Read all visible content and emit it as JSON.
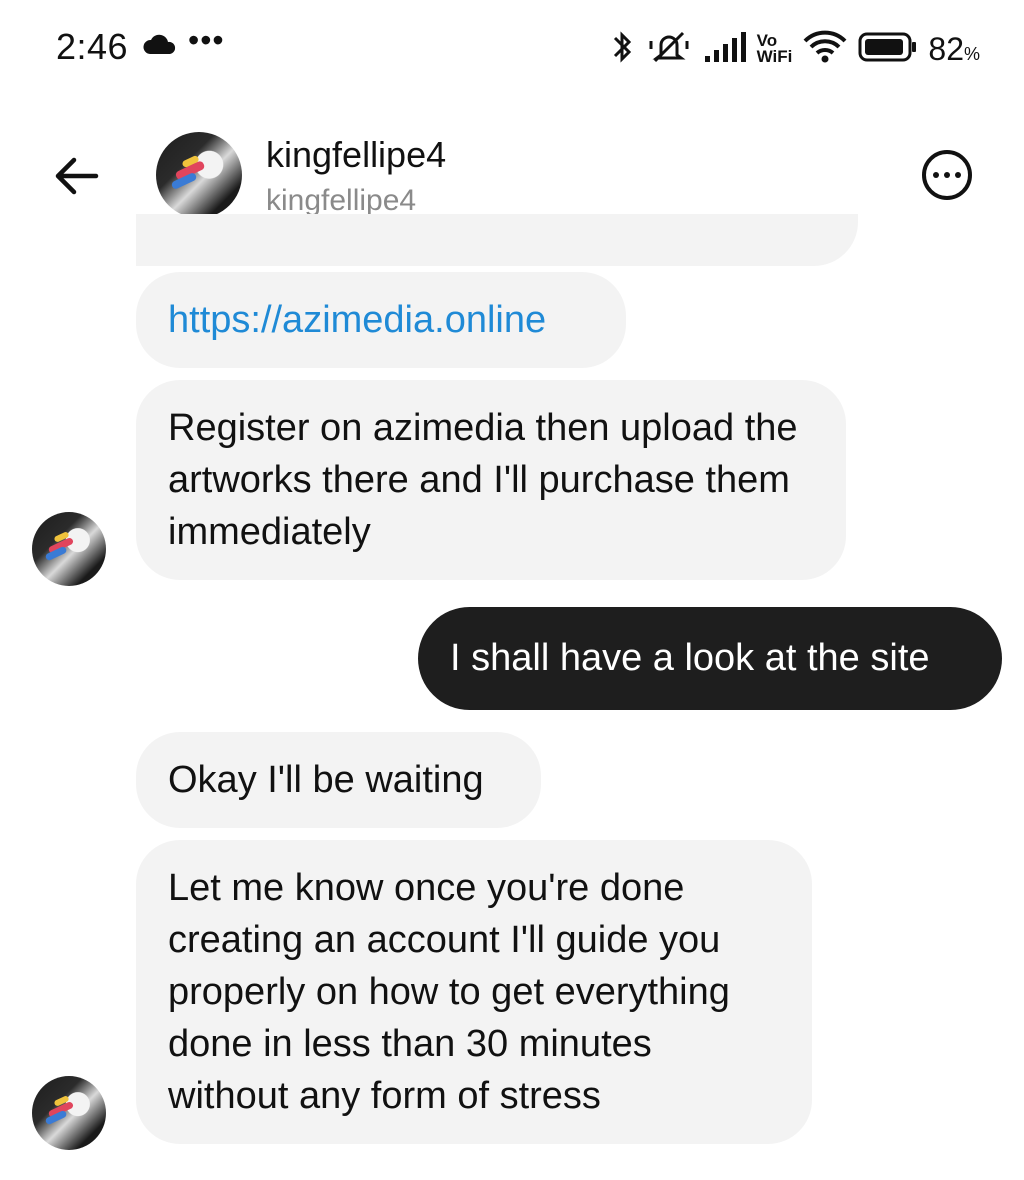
{
  "status_bar": {
    "time": "2:46",
    "overflow_dots": "•••",
    "vo_top": "Vo",
    "vo_bottom": "WiFi",
    "battery_percent": "82",
    "battery_unit": "%"
  },
  "header": {
    "display_name": "kingfellipe4",
    "username": "kingfellipe4"
  },
  "messages": [
    {
      "sender": "them",
      "text": "https://azimedia.online"
    },
    {
      "sender": "them",
      "text": "Register on azimedia then upload the artworks there and I'll purchase them immediately"
    },
    {
      "sender": "me",
      "text": "I shall have a look at the site"
    },
    {
      "sender": "them",
      "text": "Okay I'll be waiting"
    },
    {
      "sender": "them",
      "text": "Let me know once you're done creating an account I'll guide you properly on how to get everything done in less than 30 minutes without any form of stress"
    }
  ],
  "colors": {
    "incoming_bubble": "#f3f3f3",
    "outgoing_bubble": "#1e1e1e",
    "link": "#1f8ad6",
    "muted_text": "#8a8a8a"
  },
  "icons": [
    "cloud-icon",
    "bluetooth-icon",
    "mute-icon",
    "signal-icon",
    "wifi-icon",
    "battery-icon",
    "back-arrow-icon",
    "more-options-icon"
  ]
}
